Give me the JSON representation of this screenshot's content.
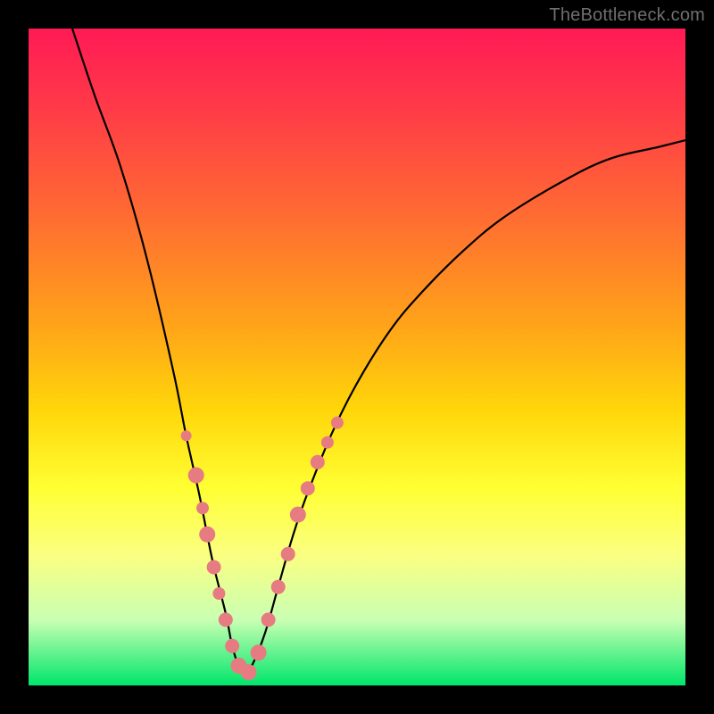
{
  "watermark": "TheBottleneck.com",
  "chart_data": {
    "type": "line",
    "title": "",
    "xlabel": "",
    "ylabel": "",
    "xlim": [
      0,
      100
    ],
    "ylim": [
      0,
      100
    ],
    "series": [
      {
        "name": "curve",
        "x": [
          6,
          10,
          14,
          18,
          22,
          24,
          26,
          28,
          30,
          31,
          32,
          33,
          34,
          36,
          38,
          40,
          42,
          46,
          50,
          55,
          60,
          66,
          72,
          80,
          88,
          96,
          100
        ],
        "y": [
          102,
          90,
          79,
          65,
          48,
          38,
          29,
          19,
          11,
          6,
          3,
          2,
          3,
          8,
          15,
          22,
          28,
          38,
          46,
          54,
          60,
          66,
          71,
          76,
          80,
          82,
          83
        ]
      }
    ],
    "markers": {
      "name": "highlight-dots",
      "color": "#e77b82",
      "points": [
        {
          "x": 24.0,
          "y": 38,
          "r": 6
        },
        {
          "x": 25.5,
          "y": 32,
          "r": 9
        },
        {
          "x": 26.5,
          "y": 27,
          "r": 7
        },
        {
          "x": 27.2,
          "y": 23,
          "r": 9
        },
        {
          "x": 28.2,
          "y": 18,
          "r": 8
        },
        {
          "x": 29.0,
          "y": 14,
          "r": 7
        },
        {
          "x": 30.0,
          "y": 10,
          "r": 8
        },
        {
          "x": 31.0,
          "y": 6,
          "r": 8
        },
        {
          "x": 32.0,
          "y": 3,
          "r": 9
        },
        {
          "x": 33.5,
          "y": 2,
          "r": 9
        },
        {
          "x": 35.0,
          "y": 5,
          "r": 9
        },
        {
          "x": 36.5,
          "y": 10,
          "r": 8
        },
        {
          "x": 38.0,
          "y": 15,
          "r": 8
        },
        {
          "x": 39.5,
          "y": 20,
          "r": 8
        },
        {
          "x": 41.0,
          "y": 26,
          "r": 9
        },
        {
          "x": 42.5,
          "y": 30,
          "r": 8
        },
        {
          "x": 44.0,
          "y": 34,
          "r": 8
        },
        {
          "x": 45.5,
          "y": 37,
          "r": 7
        },
        {
          "x": 47.0,
          "y": 40,
          "r": 7
        }
      ]
    }
  }
}
